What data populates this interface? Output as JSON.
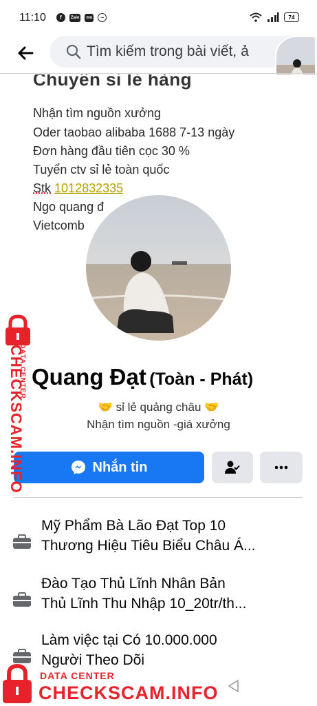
{
  "status_bar": {
    "time": "11:10",
    "battery": "74",
    "app_icons": [
      "facebook-icon",
      "zalo-icon",
      "momo-icon",
      "messenger-icon"
    ]
  },
  "search": {
    "placeholder": "Tìm kiếm trong bài viết, ả"
  },
  "cover": {
    "title": "Chuyên sỉ lẻ hàng",
    "lines": [
      "Nhận tìm nguồn xưởng",
      "Oder taobao alibaba 1688  7-13 ngày",
      "Đơn hàng đầu tiên cọc 30 %",
      "Tuyển ctv sỉ lẻ toàn quốc"
    ],
    "stk_label": "Stk",
    "stk_number": "1012832335",
    "line_name": "Ngo quang đ",
    "line_bank": "Vietcomb"
  },
  "profile": {
    "name": "Quang Đạt",
    "alt_name": "(Toàn - Phát)",
    "bio_line1": "🤝  sỉ lẻ quảng châu 🤝",
    "bio_line2": "Nhận tìm nguồn -giá xưởng"
  },
  "actions": {
    "message_label": "Nhắn tin"
  },
  "details": [
    {
      "line1": "Mỹ Phẩm Bà Lão Đạt Top 10",
      "line2": "Thương Hiệu Tiêu Biểu Châu Á..."
    },
    {
      "line1": "Đào Tạo Thủ Lĩnh Nhân Bản",
      "line2": "Thủ Lĩnh Thu Nhập 10_20tr/th..."
    },
    {
      "line1": "Làm việc tại Có 10.000.000",
      "line2": "Người Theo Dõi"
    }
  ],
  "watermark": {
    "side_text": "CHECKSCAM.INFO",
    "side_sub": "DATA CENTER",
    "bottom_sub": "DATA CENTER",
    "bottom_text": "CHECKSCAM.INFO"
  },
  "colors": {
    "accent": "#1877f2",
    "watermark": "#e8222a",
    "button_bg": "#e4e6eb"
  }
}
